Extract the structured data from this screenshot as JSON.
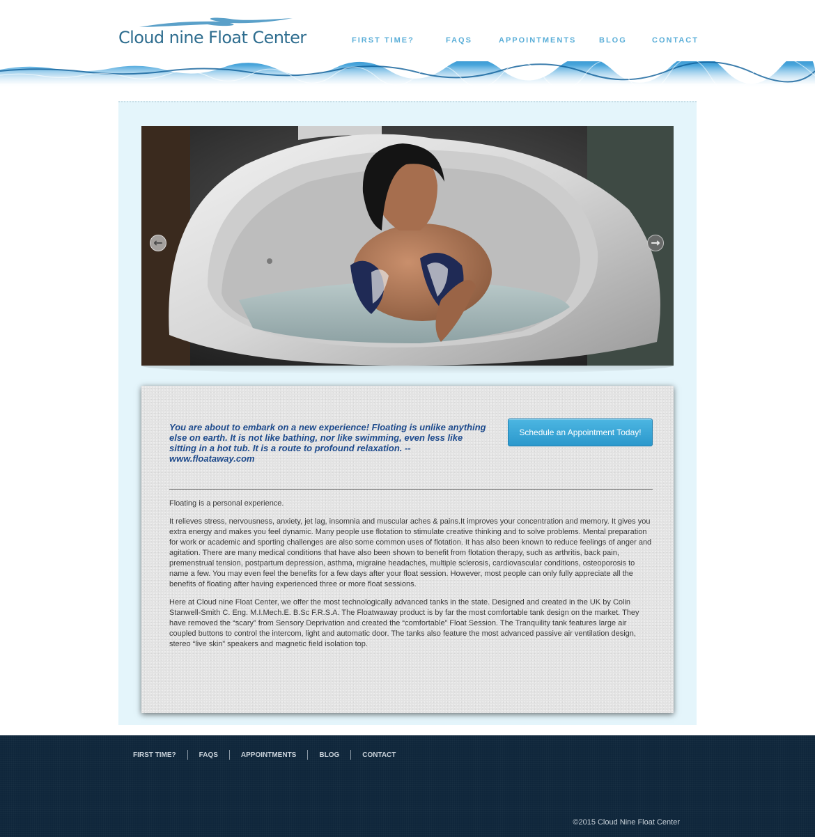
{
  "brand": {
    "logo_text": "Cloud nine Float Center"
  },
  "nav": {
    "first_time": "FIRST TIME?",
    "faqs": "FAQS",
    "appointments": "APPOINTMENTS",
    "blog": "BLOG",
    "contact": "CONTACT"
  },
  "slider": {
    "prev_icon": "arrow-left-icon",
    "next_icon": "arrow-right-icon",
    "prev_glyph": "←",
    "next_glyph": "→"
  },
  "intro": {
    "quote": "You are about to embark on a new experience! Floating is unlike anything else on earth. It is not like bathing, nor like swimming, even less like sitting in a hot tub. It is a route to profound relaxation. -- www.floataway.com",
    "cta_label": "Schedule an Appointment Today!"
  },
  "body": {
    "paragraph_1": "Floating is a personal experience.",
    "paragraph_2": "It relieves stress, nervousness, anxiety, jet lag, insomnia and muscular aches & pains.It improves your concentration and memory. It gives you extra energy and makes you feel dynamic. Many people use flotation to stimulate creative thinking and to solve problems. Mental preparation for work or academic and sporting challenges are also some common uses of flotation. It has also been known to reduce feelings of anger and agitation. There are many medical conditions that have also been shown to benefit from flotation therapy, such as arthritis, back pain, premenstrual tension, postpartum depression, asthma, migraine headaches, multiple sclerosis, cardiovascular conditions, osteoporosis to name a few. You may even feel the benefits for a few days after your float session. However, most people can only fully appreciate all the benefits of floating after having experienced three or more float sessions.",
    "paragraph_3": "Here at Cloud nine Float Center, we offer the most technologically advanced tanks in the state. Designed and created in the UK by Colin Stanwell-Smith C. Eng. M.I.Mech.E. B.Sc F.R.S.A. The Floatwaway product is by far the most comfortable tank design on the market. They have removed the “scary” from Sensory Deprivation and created the “comfortable” Float Session. The Tranquility tank features large air coupled buttons to control the intercom, light and automatic door. The tanks also feature the most advanced passive air ventilation design, stereo “live skin” speakers and magnetic field isolation top."
  },
  "footer": {
    "nav": {
      "first_time": "FIRST TIME?",
      "faqs": "FAQS",
      "appointments": "APPOINTMENTS",
      "blog": "BLOG",
      "contact": "CONTACT"
    },
    "copyright": "©2015 Cloud Nine Float Center"
  },
  "colors": {
    "accent": "#5aaed8",
    "logo": "#2e6d8f",
    "quote": "#1d4a8c",
    "button": "#2b98cc",
    "panel_bg": "#e4f5fb",
    "footer_bg": "#0f263b"
  }
}
